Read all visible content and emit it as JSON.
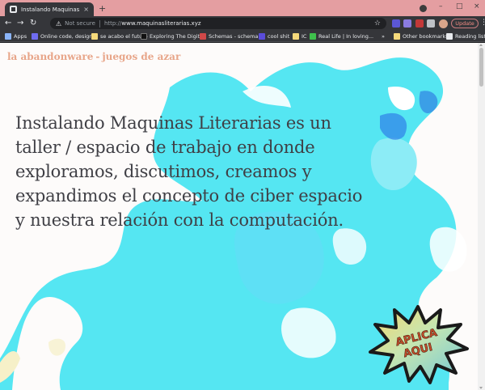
{
  "browser": {
    "tab_title": "Instalando Maquinas Literarias",
    "tab_close": "×",
    "new_tab": "+",
    "security_label": "Not secure",
    "url_scheme": "http://",
    "url_host": "www.maquinasliterarias.xyz",
    "update_label": "Update",
    "window_controls": {
      "minimize": "–",
      "maximize": "□",
      "close": "×"
    },
    "nav": {
      "back": "←",
      "forward": "→",
      "reload": "↻"
    }
  },
  "bookmarks": {
    "items": [
      {
        "label": "Apps",
        "icon": "apps-grid-icon",
        "color": "#8ab4f8"
      },
      {
        "label": "Online code, design...",
        "icon": "code-icon",
        "color": "#6f6cf0"
      },
      {
        "label": "se acabo el futuro",
        "icon": "folder-icon",
        "color": "#f5d97b"
      },
      {
        "label": "Exploring The Digit...",
        "icon": "site-icon",
        "color": "#111111"
      },
      {
        "label": "Schemas - schema...",
        "icon": "site-icon",
        "color": "#d04848"
      },
      {
        "label": "cool shit",
        "icon": "site-icon",
        "color": "#5a4cd9"
      },
      {
        "label": "IC",
        "icon": "folder-icon",
        "color": "#f5d97b"
      },
      {
        "label": "Real Life | In loving...",
        "icon": "site-icon",
        "color": "#3ec14c"
      },
      {
        "label": "»",
        "icon": "",
        "color": ""
      },
      {
        "label": "Other bookmarks",
        "icon": "folder-icon",
        "color": "#f5d97b"
      },
      {
        "label": "Reading list",
        "icon": "reading-list-icon",
        "color": "#e8eaed"
      }
    ]
  },
  "site": {
    "header_left": "la abandonware",
    "header_sep": "-",
    "header_right": "juegos de azar",
    "hero_text": "Instalando Maquinas Literarias es un taller / espacio de trabajo en donde exploramos, discutimos, creamos y expandimos el concepto de ciber espacio y nuestra relación con la computación.",
    "apply_line1": "APLICA",
    "apply_line2": "AQUI"
  },
  "colors": {
    "tabstrip": "#e49ea1",
    "cyan": "#55e6f2",
    "peach": "#f2a57e",
    "header_text": "#e8a68a",
    "hero_text": "#3f3f45"
  }
}
